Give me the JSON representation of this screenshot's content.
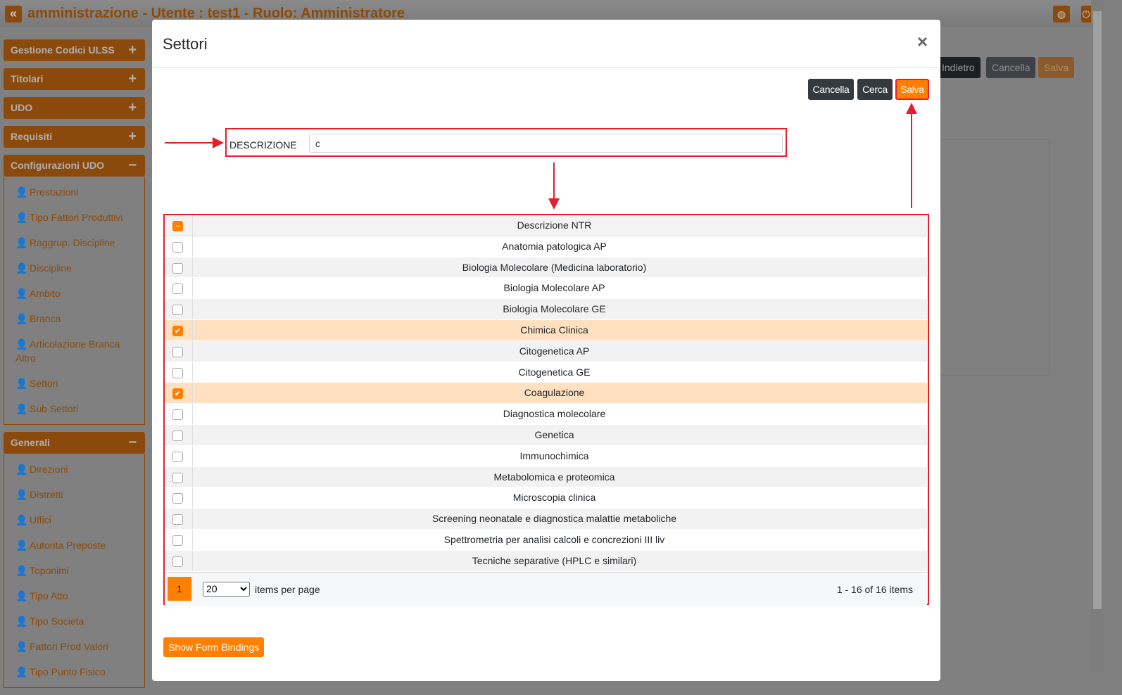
{
  "header": {
    "title": "amministrazione - Utente : test1 - Ruolo: Amministratore",
    "icons": [
      "chevrons-left-icon",
      "globe-icon",
      "power-icon"
    ]
  },
  "sidebar": {
    "sections": [
      {
        "label": "Gestione Codici ULSS",
        "toggle": "+"
      },
      {
        "label": "Titolari",
        "toggle": "+"
      },
      {
        "label": "UDO",
        "toggle": "+"
      },
      {
        "label": "Requisiti",
        "toggle": "+"
      },
      {
        "label": "Configurazioni UDO",
        "toggle": "−",
        "items": [
          "Prestazioni",
          "Tipo Fattori Produttivi",
          "Raggrup. Discipline",
          "Discipline",
          "Ambito",
          "Branca",
          "Articolazione Branca Altro",
          "Settori",
          "Sub Settori"
        ]
      },
      {
        "label": "Generali",
        "toggle": "−",
        "items": [
          "Direzioni",
          "Distretti",
          "Uffici",
          "Autorita Preposte",
          "Toponimi",
          "Tipo Atto",
          "Tipo Societa",
          "Fattori Prod Valori",
          "Tipo Punto Fisico"
        ]
      }
    ]
  },
  "background_buttons": {
    "indietro": "Indietro",
    "cancella": "Cancella",
    "salva": "Salva"
  },
  "modal": {
    "title": "Settori",
    "close": "×",
    "buttons": {
      "cancella": "Cancella",
      "cerca": "Cerca",
      "salva": "Salva"
    },
    "filter": {
      "label": "DESCRIZIONE",
      "value": "c"
    },
    "grid": {
      "header": "Descrizione NTR",
      "rows": [
        {
          "label": "Anatomia patologica AP",
          "checked": false
        },
        {
          "label": "Biologia Molecolare (Medicina laboratorio)",
          "checked": false
        },
        {
          "label": "Biologia Molecolare AP",
          "checked": false
        },
        {
          "label": "Biologia Molecolare GE",
          "checked": false
        },
        {
          "label": "Chimica Clinica",
          "checked": true
        },
        {
          "label": "Citogenetica AP",
          "checked": false
        },
        {
          "label": "Citogenetica GE",
          "checked": false
        },
        {
          "label": "Coagulazione",
          "checked": true
        },
        {
          "label": "Diagnostica molecolare",
          "checked": false
        },
        {
          "label": "Genetica",
          "checked": false
        },
        {
          "label": "Immunochimica",
          "checked": false
        },
        {
          "label": "Metabolomica e proteomica",
          "checked": false
        },
        {
          "label": "Microscopia clinica",
          "checked": false
        },
        {
          "label": "Screening neonatale e diagnostica malattie metaboliche",
          "checked": false
        },
        {
          "label": "Spettrometria per analisi calcoli e concrezioni III liv",
          "checked": false
        },
        {
          "label": "Tecniche separative (HPLC e similari)",
          "checked": false
        }
      ]
    },
    "pager": {
      "page": "1",
      "page_size": "20",
      "items_per_page": "items per page",
      "count": "1 - 16 of 16 items"
    },
    "show_form_bindings": "Show Form Bindings"
  },
  "colors": {
    "accent": "#ff8000",
    "annotation": "#e3202b",
    "dark_button": "#343a40"
  }
}
